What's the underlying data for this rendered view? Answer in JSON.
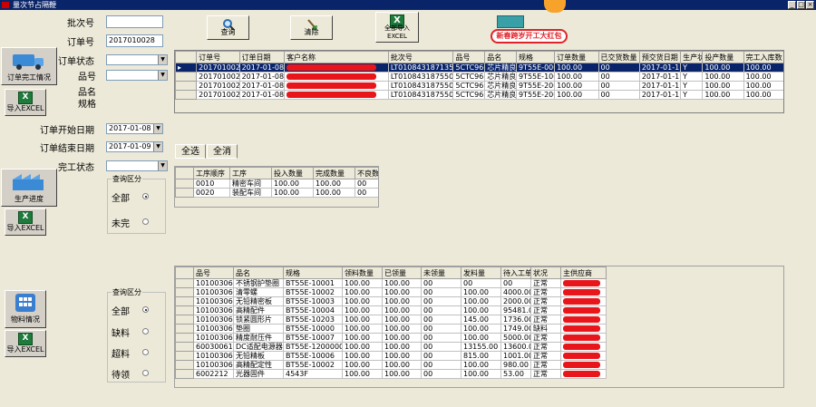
{
  "window": {
    "title": "量次节占隔鞭",
    "min_label": "_",
    "max_label": "□",
    "close_label": "×"
  },
  "form": {
    "batch_label": "批次号",
    "batch_value": "",
    "order_label": "订单号",
    "order_value": "2017010028",
    "order_status_label": "订单状态",
    "order_status_value": "",
    "part_label": "品号",
    "part_value": "",
    "name_spec_label": "品名\n规格",
    "start_date_label": "订单开始日期",
    "start_date_value": "2017-01-08",
    "end_date_label": "订单结束日期",
    "end_date_value": "2017-01-09",
    "finish_status_label": "完工状态",
    "finish_status_value": ""
  },
  "sidebar": {
    "section1_label": "订单完工情况",
    "export1_label": "导入EXCEL",
    "section2_label": "生产进度",
    "export2_label": "导入EXCEL",
    "section3_label": "物料情况",
    "export3_label": "导入EXCEL"
  },
  "toolbar": {
    "query_label": "查询",
    "clear_label": "清除",
    "export_label": "全部导入EXCEL",
    "promo_label": "新春跨岁开工大红包"
  },
  "orders": {
    "columns": [
      "订单号",
      "订单日期",
      "客户名称",
      "批次号",
      "品号",
      "品名",
      "规格",
      "订单数量",
      "已交货数量",
      "预交货日期",
      "生产状态",
      "投产数量",
      "完工入库数"
    ],
    "rows": [
      {
        "order": "2017010028",
        "date": "2017-01-08",
        "batch": "LT01084318713504",
        "part": "5CTC96040",
        "name": "芯片精良",
        "spec": "9T55E-000",
        "qty": "100.00",
        "delivered": "00",
        "due": "2017-01-11",
        "status": "Y",
        "produced": "100.00",
        "finished": "100.00",
        "selected": true
      },
      {
        "order": "2017010028",
        "date": "2017-01-08",
        "batch": "LT01084318755091",
        "part": "5CTC96045",
        "name": "芯片精良",
        "spec": "9T55E-100",
        "qty": "100.00",
        "delivered": "00",
        "due": "2017-01-11",
        "status": "Y",
        "produced": "100.00",
        "finished": "100.00",
        "selected": false
      },
      {
        "order": "2017010028",
        "date": "2017-01-08",
        "batch": "LT01084318755093",
        "part": "5CTC96046",
        "name": "芯片精良",
        "spec": "9T55E-200",
        "qty": "100.00",
        "delivered": "00",
        "due": "2017-01-11",
        "status": "Y",
        "produced": "100.00",
        "finished": "100.00",
        "selected": false
      },
      {
        "order": "2017010028",
        "date": "2017-01-08",
        "batch": "LT01084318755094",
        "part": "5CTC96054",
        "name": "芯片精良",
        "spec": "9T55E-200",
        "qty": "100.00",
        "delivered": "00",
        "due": "2017-01-11",
        "status": "Y",
        "produced": "100.00",
        "finished": "100.00",
        "selected": false
      }
    ]
  },
  "tabs": {
    "select_all": "全选",
    "select_none": "全消"
  },
  "progress": {
    "columns": [
      "工序顺序",
      "工序",
      "投入数量",
      "完成数量",
      "不良数量"
    ],
    "rows": [
      {
        "seq": "0010",
        "op": "精密车间",
        "in": "100.00",
        "done": "100.00",
        "bad": "00"
      },
      {
        "seq": "0020",
        "op": "装配车间",
        "in": "100.00",
        "done": "100.00",
        "bad": "00"
      }
    ],
    "filter_title": "查询区分",
    "opt_all": "全部",
    "opt_not": "未完"
  },
  "materials": {
    "columns": [
      "品号",
      "品名",
      "规格",
      "领料数量",
      "已领量",
      "未领量",
      "发料量",
      "待入工单",
      "状况",
      "主供应商"
    ],
    "rows": [
      {
        "part": "10100306212",
        "name": "不锈钢护垫圈",
        "spec": "BT55E-10001",
        "req": "100.00",
        "got": "100.00",
        "left": "00",
        "issued": "00",
        "wait": "00",
        "state": "正常"
      },
      {
        "part": "10100306213",
        "name": "清零螺",
        "spec": "BT55E-10002",
        "req": "100.00",
        "got": "100.00",
        "left": "00",
        "issued": "100.00",
        "wait": "4000.00",
        "state": "正常"
      },
      {
        "part": "10100306214",
        "name": "无铅精密板",
        "spec": "BT55E-10003",
        "req": "100.00",
        "got": "100.00",
        "left": "00",
        "issued": "100.00",
        "wait": "2000.00",
        "state": "正常"
      },
      {
        "part": "10100306215",
        "name": "高精配件",
        "spec": "BT55E-10004",
        "req": "100.00",
        "got": "100.00",
        "left": "00",
        "issued": "100.00",
        "wait": "95481.00",
        "state": "正常"
      },
      {
        "part": "10100306208",
        "name": "锁紧圆形片",
        "spec": "BT55E-10203",
        "req": "100.00",
        "got": "100.00",
        "left": "00",
        "issued": "145.00",
        "wait": "1736.00",
        "state": "正常"
      },
      {
        "part": "10100306209",
        "name": "垫圈",
        "spec": "BT55E-10000",
        "req": "100.00",
        "got": "100.00",
        "left": "00",
        "issued": "100.00",
        "wait": "1749.00",
        "state": "缺料"
      },
      {
        "part": "10100306207",
        "name": "精度耐压件",
        "spec": "BT55E-10007",
        "req": "100.00",
        "got": "100.00",
        "left": "00",
        "issued": "100.00",
        "wait": "5000.00",
        "state": "正常"
      },
      {
        "part": "60030061",
        "name": "DC适配电源器",
        "spec": "BT55E-12000000",
        "req": "100.00",
        "got": "100.00",
        "left": "00",
        "issued": "13155.00",
        "wait": "13600.00",
        "state": "正常"
      },
      {
        "part": "10100306205",
        "name": "无铅精板",
        "spec": "BT55E-10006",
        "req": "100.00",
        "got": "100.00",
        "left": "00",
        "issued": "815.00",
        "wait": "1001.00",
        "state": "正常"
      },
      {
        "part": "10100306206",
        "name": "高精配定性",
        "spec": "BT55E-10002",
        "req": "100.00",
        "got": "100.00",
        "left": "00",
        "issued": "100.00",
        "wait": "980.00",
        "state": "正常"
      },
      {
        "part": "6002212",
        "name": "光器固件",
        "spec": "4543F",
        "req": "100.00",
        "got": "100.00",
        "left": "00",
        "issued": "100.00",
        "wait": "53.00",
        "state": "正常"
      }
    ],
    "filter_title": "查询区分",
    "opt_all": "全部",
    "opt_short": "缺料",
    "opt_over": "超料",
    "opt_abnormal": "待领"
  }
}
